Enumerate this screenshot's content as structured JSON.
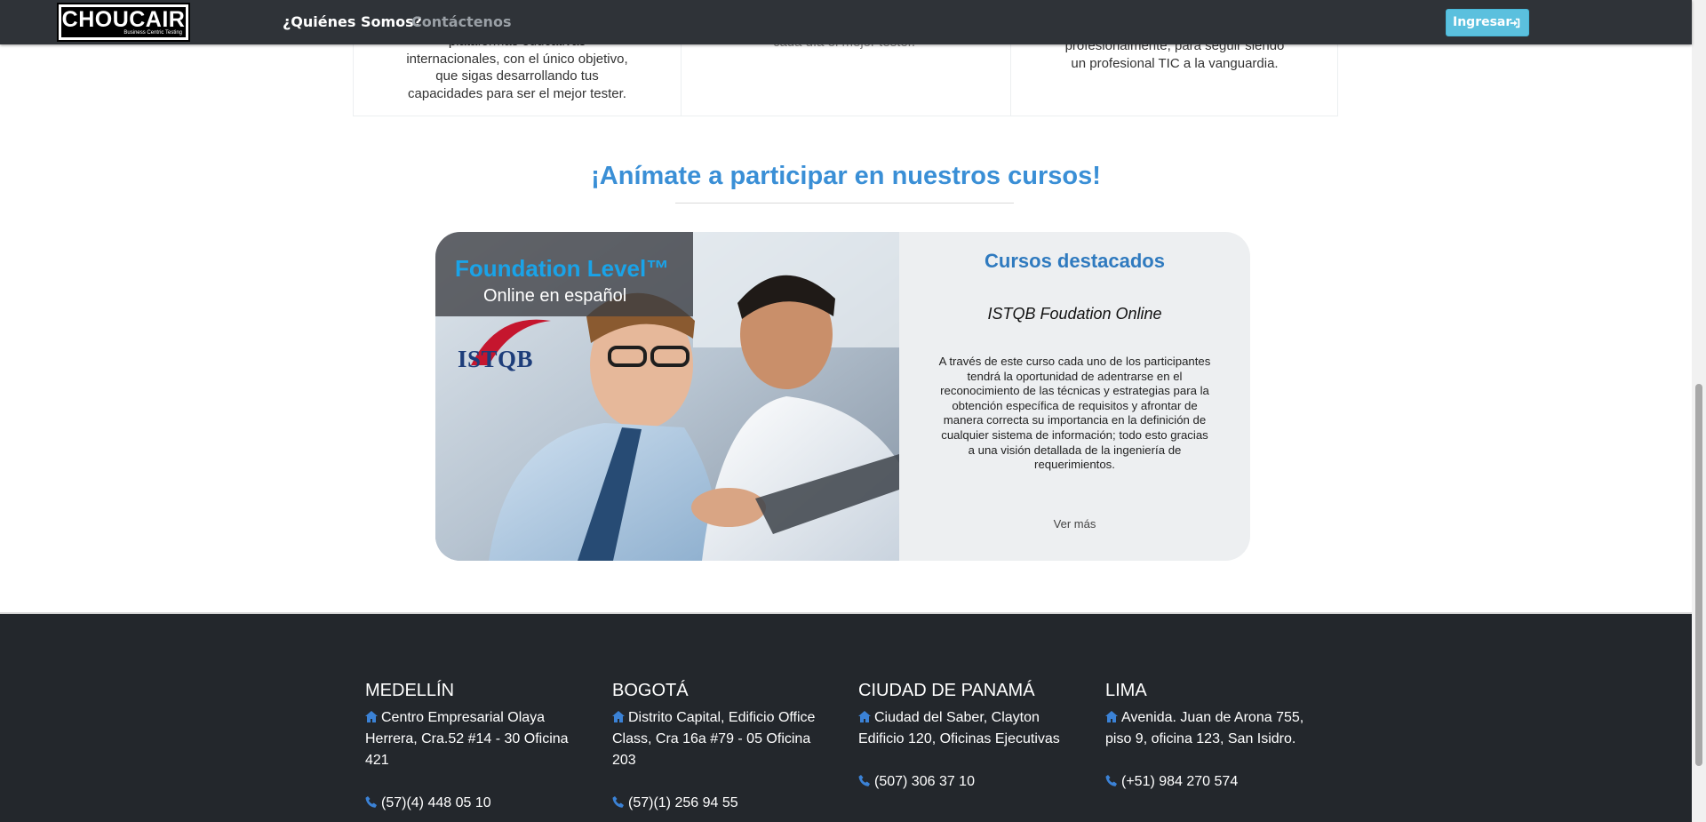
{
  "navbar": {
    "logo_text": "CHOUCAIR",
    "logo_tagline": "Business Centric Testing",
    "links": {
      "who": "¿Quiénes Somos?",
      "contact": "Contáctenos"
    },
    "login_label": "Ingresar"
  },
  "cards": {
    "left_lines": [
      "plataformas educativas",
      "internacionales, con el único objetivo,",
      "que sigas desarrollando tus",
      "capacidades para ser el mejor tester."
    ],
    "middle_lines": [
      "cada día el mejor tester."
    ],
    "right_lines": [
      "profesionalmente, para seguir siendo",
      "un profesional TIC a la vanguardia."
    ]
  },
  "section": {
    "title": "¡Anímate a participar en nuestros cursos!"
  },
  "course": {
    "image_title": "Foundation Level™",
    "image_subtitle": "Online en español",
    "image_brand": "ISTQB",
    "heading": "Cursos destacados",
    "name": "ISTQB Foudation Online",
    "description_lines": [
      "A través de este curso cada uno de los participantes",
      "tendrá la oportunidad de adentrarse en el",
      "reconocimiento de las técnicas y estrategias para la",
      "obtención específica de requisitos y afrontar de",
      "manera correcta su importancia en la definición de",
      "cualquier sistema de información; todo esto gracias",
      "a una visión detallada de la ingeniería de",
      "requerimientos."
    ],
    "more_label": "Ver más"
  },
  "footer": {
    "offices": [
      {
        "city": "MEDELLÍN",
        "address_lines": [
          "Centro Empresarial Olaya",
          "Herrera, Cra.52 #14 - 30 Oficina",
          "421"
        ],
        "phone": "(57)(4) 448 05 10"
      },
      {
        "city": "BOGOTÁ",
        "address_lines": [
          "Distrito Capital, Edificio Office",
          "Class, Cra 16a #79 - 05 Oficina 203"
        ],
        "phone": "(57)(1) 256 94 55"
      },
      {
        "city": "CIUDAD DE PANAMÁ",
        "address_lines": [
          "Ciudad del Saber, Clayton",
          "Edificio 120, Oficinas Ejecutivas"
        ],
        "phone": "(507) 306 37 10"
      },
      {
        "city": "LIMA",
        "address_lines": [
          "Avenida. Juan de Arona 755,",
          "piso 9, oficina 123, San Isidro."
        ],
        "phone": "(+51) 984 270 574"
      }
    ]
  },
  "colors": {
    "navbar_bg": "#2f3338",
    "accent_blue": "#3a8fd6",
    "login_button": "#5bc0de",
    "footer_bg": "#23272c",
    "icon_blue": "#3b82d6"
  },
  "icons": {
    "login": "sign-in-icon",
    "address": "home-icon",
    "phone": "phone-icon"
  }
}
